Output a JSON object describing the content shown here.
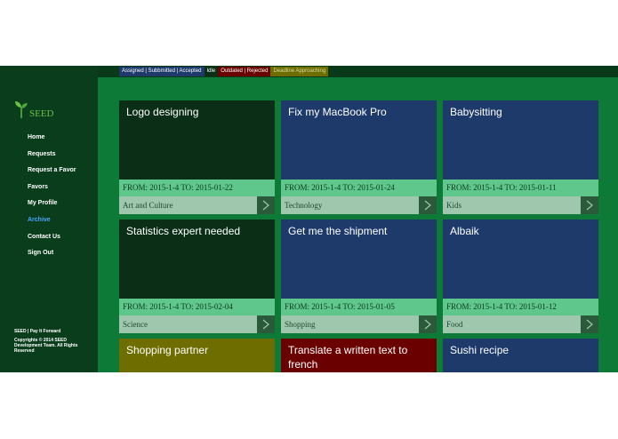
{
  "legend": {
    "assigned": "Assigned | Subbmitted | Accepted",
    "idle": "Idle",
    "outdated": "Outdated | Rejected",
    "deadline": "Deadline Approaching"
  },
  "brand": {
    "name": "SEED"
  },
  "nav": [
    {
      "label": "Home"
    },
    {
      "label": "Requests"
    },
    {
      "label": "Request a Favor"
    },
    {
      "label": "Favors"
    },
    {
      "label": "My Profile"
    },
    {
      "label": "Archive"
    },
    {
      "label": "Contact Us"
    },
    {
      "label": "Sign Out"
    }
  ],
  "footer": {
    "tagline": "SEED | Pay It Forward",
    "copyright": "Copyrights © 2014 SEED Development Team. All Rights Reserved"
  },
  "colors": {
    "assigned": "#1e3a6b",
    "idle": "#0a2f16",
    "outdated": "#6b0000",
    "deadline": "#6e6e00",
    "active_nav": "#4da3ff"
  },
  "cards": [
    {
      "title": "Logo designing",
      "dates": "FROM: 2015-1-4 TO: 2015-01-22",
      "category": "Art and Culture",
      "status": "idle"
    },
    {
      "title": "Fix my MacBook Pro",
      "dates": "FROM: 2015-1-4 TO: 2015-01-24",
      "category": "Technology",
      "status": "assigned"
    },
    {
      "title": "Babysitting",
      "dates": "FROM: 2015-1-4 TO: 2015-01-11",
      "category": "Kids",
      "status": "assigned"
    },
    {
      "title": "Statistics expert needed",
      "dates": "FROM: 2015-1-4 TO: 2015-02-04",
      "category": "Science",
      "status": "idle"
    },
    {
      "title": "Get me the shipment",
      "dates": "FROM: 2015-1-4 TO: 2015-01-05",
      "category": "Shopping",
      "status": "assigned"
    },
    {
      "title": "Albaik",
      "dates": "FROM: 2015-1-4 TO: 2015-01-12",
      "category": "Food",
      "status": "assigned"
    },
    {
      "title": "Shopping partner",
      "dates": "",
      "category": "",
      "status": "deadline"
    },
    {
      "title": "Translate a written text to french",
      "dates": "",
      "category": "",
      "status": "outdated"
    },
    {
      "title": "Sushi recipe",
      "dates": "",
      "category": "",
      "status": "assigned"
    }
  ]
}
